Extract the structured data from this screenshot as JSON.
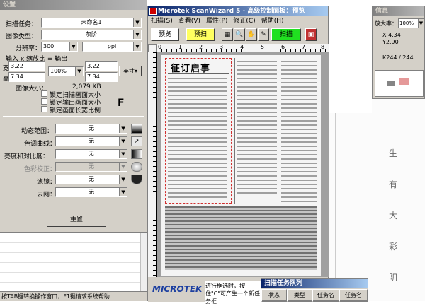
{
  "settings": {
    "title": "设置",
    "task_label": "扫描任务：",
    "task_value": "未命名1",
    "image_type_label": "图像类型：",
    "image_type_value": "灰阶",
    "resolution_label": "分辨率：",
    "resolution_value": "300",
    "unit_value": "ppi",
    "io_label": "输入 x 缩放比 = 输出",
    "width_label": "宽：",
    "height_label": "高：",
    "in_width": "3.22",
    "in_height": "7.34",
    "scale": "100%",
    "out_width": "3.22",
    "out_height": "7.34",
    "size_unit": "英寸",
    "image_size_label": "图像大小：",
    "image_size_value": "2,079 KB",
    "lock_scan": "锁定扫描画面大小",
    "lock_output": "锁定输出画面大小",
    "lock_ratio": "锁定画面长宽比例",
    "f_label": "F",
    "dynamic_range_label": "动态范围：",
    "dynamic_range_value": "无",
    "tone_curve_label": "色调曲线：",
    "tone_curve_value": "无",
    "brightness_label": "亮度和对比度：",
    "brightness_value": "无",
    "color_correction_label": "色彩校正：",
    "color_correction_value": "无",
    "filter_label": "滤镜：",
    "filter_value": "无",
    "descreen_label": "去网：",
    "descreen_value": "无",
    "reset_button": "重置"
  },
  "status_bar": "按TAB键转换操作窗口，F1键请求系统帮助",
  "main": {
    "title": "Microtek ScanWizard 5 - 高级控制面板：预览",
    "menu": [
      "扫描(S)",
      "查看(V)",
      "属性(P)",
      "修正(C)",
      "帮助(H)"
    ],
    "preview_button": "预览",
    "prescan_button": "预扫",
    "scan_button": "扫描",
    "ruler_labels": [
      "0",
      "1",
      "2",
      "3",
      "4",
      "5",
      "6",
      "7",
      "8"
    ],
    "doc_heading": "征订启事"
  },
  "info": {
    "title": "信息",
    "zoom_label": "放大率：",
    "zoom_value": "100%",
    "coord_x": "X 4.34",
    "coord_y": "Y2.90",
    "k_readout": "K244 / 244"
  },
  "queue": {
    "title": "扫描任务队列",
    "headers": [
      "状态",
      "类型",
      "任务名",
      "任务名"
    ]
  },
  "footer": {
    "logo": "MICROTEK",
    "message": "进行框选时，按住\"C\"可产生一个新任务框"
  },
  "background": {
    "chars": [
      "生",
      "有",
      "大",
      "彩",
      "阴"
    ]
  }
}
